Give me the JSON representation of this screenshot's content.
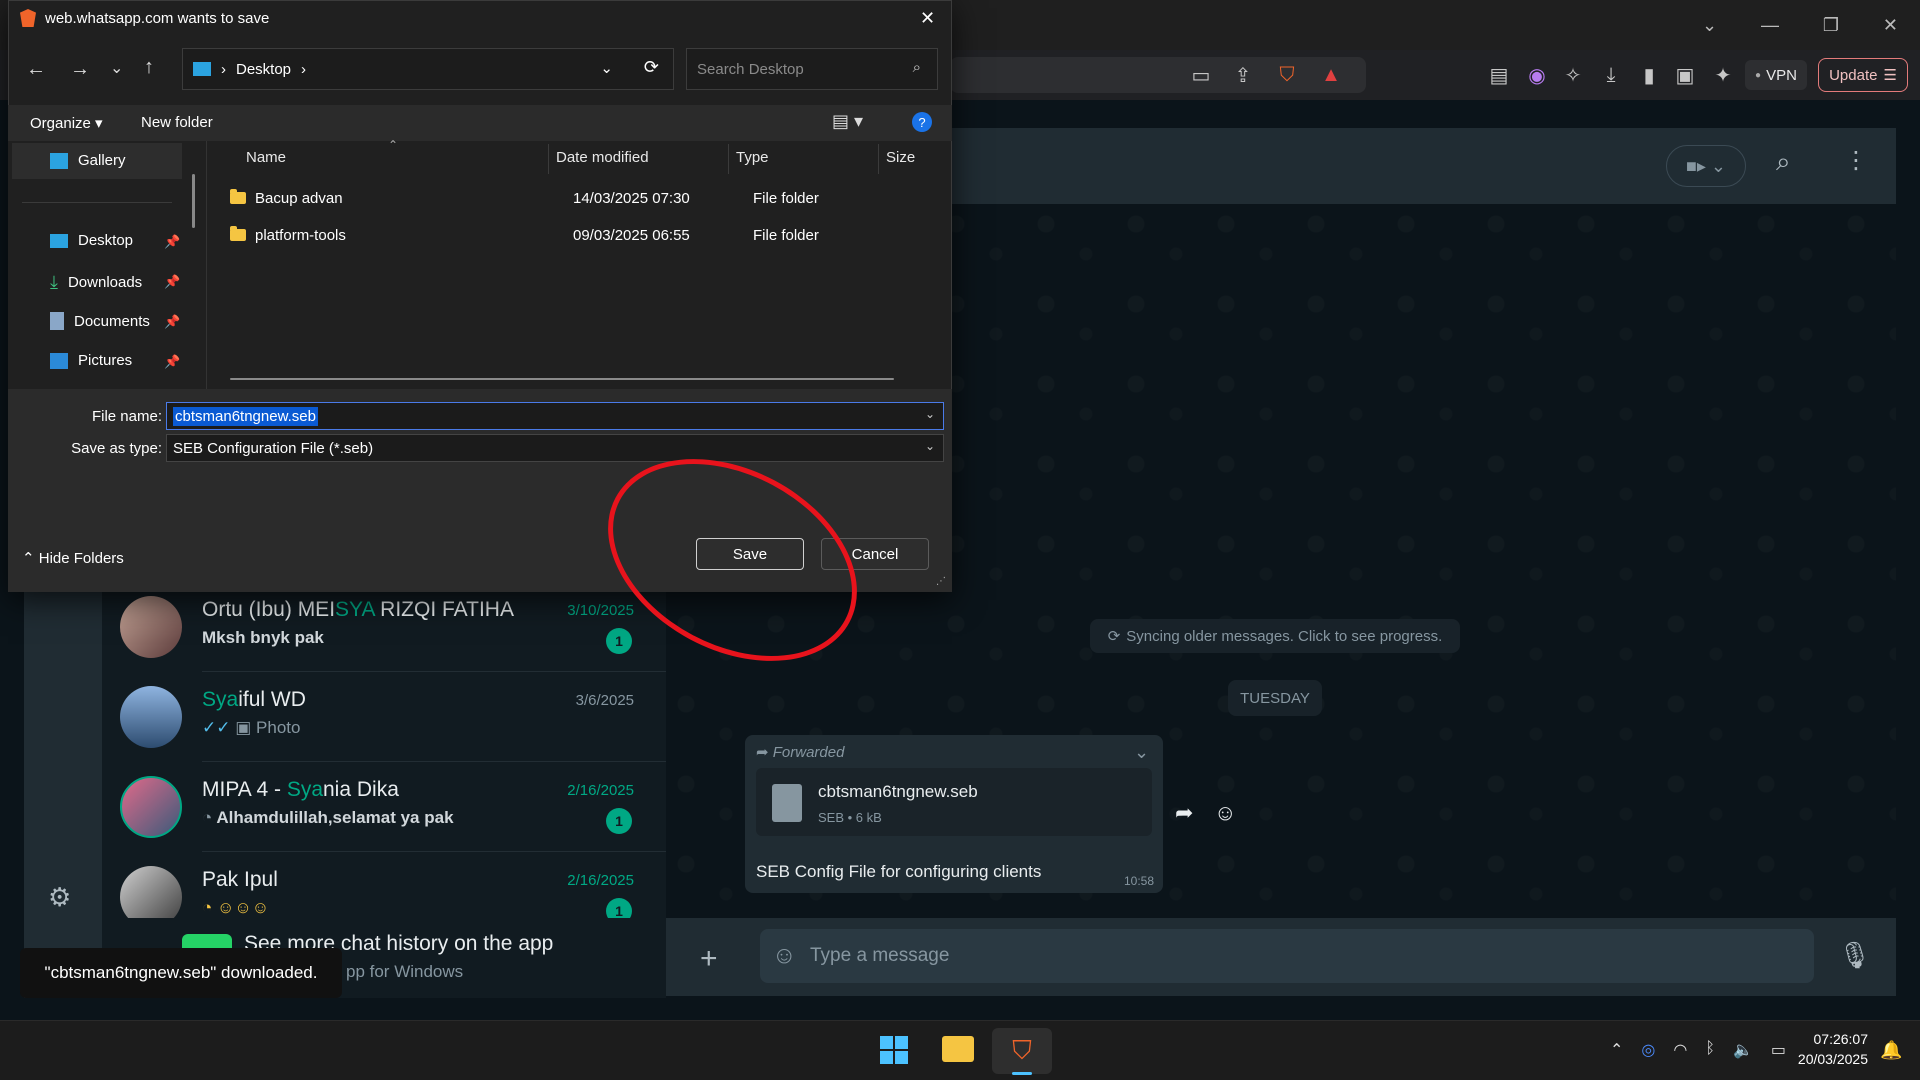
{
  "dialog": {
    "title": "web.whatsapp.com wants to save",
    "address_segment": "Desktop",
    "search_placeholder": "Search Desktop",
    "organize_label": "Organize",
    "new_folder_label": "New folder",
    "nav": [
      {
        "label": "Gallery"
      },
      {
        "label": "Desktop"
      },
      {
        "label": "Downloads"
      },
      {
        "label": "Documents"
      },
      {
        "label": "Pictures"
      }
    ],
    "columns": [
      "Name",
      "Date modified",
      "Type",
      "Size"
    ],
    "files": [
      {
        "name": "Bacup advan",
        "date": "14/03/2025 07:30",
        "type": "File folder"
      },
      {
        "name": "platform-tools",
        "date": "09/03/2025 06:55",
        "type": "File folder"
      }
    ],
    "file_name_label": "File name:",
    "file_name_value": "cbtsman6tngnew.seb",
    "save_type_label": "Save as type:",
    "save_type_value": "SEB Configuration File (*.seb)",
    "hide_folders_label": "Hide Folders",
    "save_label": "Save",
    "cancel_label": "Cancel"
  },
  "browser": {
    "vpn_label": "VPN",
    "update_label": "Update"
  },
  "chats": [
    {
      "name_a": "Ortu (Ibu) MEI",
      "name_hl": "SYA",
      "name_b": " RIZQI FATIHA",
      "preview": "Mksh bnyk pak",
      "date": "3/10/2025",
      "badge": "1"
    },
    {
      "name_a": "",
      "name_hl": "Sya",
      "name_b": "iful WD",
      "preview": "Photo",
      "date": "3/6/2025",
      "badge": ""
    },
    {
      "name_a": "MIPA 4 - ",
      "name_hl": "Sya",
      "name_b": "nia Dika",
      "preview": "Alhamdulillah,selamat ya pak",
      "date": "2/16/2025",
      "badge": "1"
    },
    {
      "name_a": "Pak Ipul",
      "name_hl": "",
      "name_b": "",
      "preview": "",
      "date": "2/16/2025",
      "badge": "1"
    }
  ],
  "chat": {
    "sync_text": "Syncing older messages. Click to see progress.",
    "day_label": "TUESDAY",
    "forwarded_label": "Forwarded",
    "file_name": "cbtsman6tngnew.seb",
    "file_meta": "SEB • 6 kB",
    "caption": "SEB Config File for configuring clients",
    "time": "10:58",
    "composer_placeholder": "Type a message"
  },
  "promo": {
    "title": "See more chat history on the app",
    "subtitle": "pp for Windows"
  },
  "toast": "\"cbtsman6tngnew.seb\" downloaded.",
  "taskbar": {
    "time": "07:26:07",
    "date": "20/03/2025"
  }
}
